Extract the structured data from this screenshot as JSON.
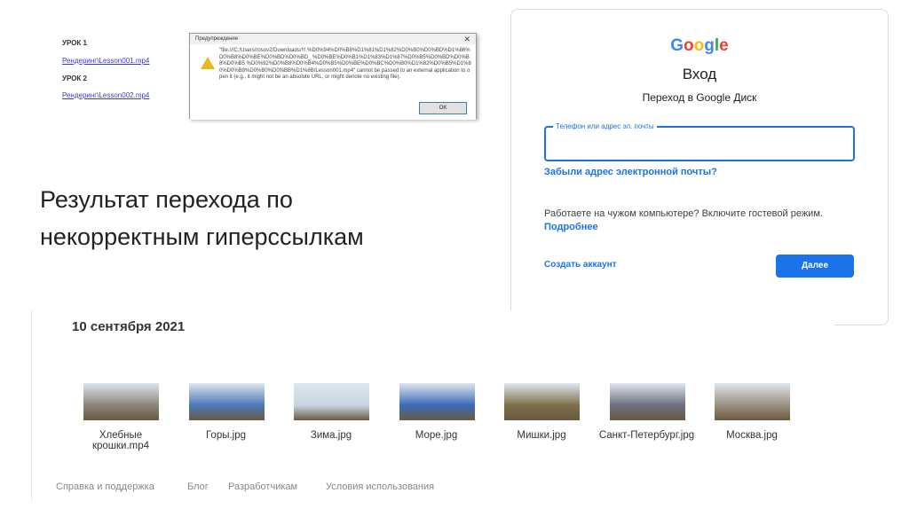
{
  "doc": {
    "lessons": [
      {
        "title": "УРОК 1",
        "link": "Рендеринг\\Lesson001.mp4"
      },
      {
        "title": "УРОК 2",
        "link": "Рендеринг\\Lesson002.mp4"
      }
    ]
  },
  "dialog": {
    "title": "Предупреждение",
    "close": "✕",
    "message": "\"file:///C:/Users/rosov2/Downloads/!!! %D0%94%D0%B8%D1%81%D1%82%D0%B0%D0%BD%D1%86%D0%B8%D0%BE%D0%BD%D0%BD_ %D0%BE%D0%B1%D1%83%D1%87%D0%B5%D0%BD%D0%B8%D0%B5 %D0%92%D0%B8%D0%B4%D0%B5%D0%BE%D0%BC%D0%B0%D1%82%D0%B5%D1%80%D0%B8%D0%B0%D0%BB%D1%8B/Lesson001.mp4\" cannot be passed to an external application to open it (e.g., it might not be an absolute URL, or might denote no existing file).",
    "ok": "OK"
  },
  "google": {
    "logo": "Google",
    "title": "Вход",
    "subtitle": "Переход в Google Диск",
    "field_label": "Телефон или адрес эл. почты",
    "field_value": "",
    "forgot": "Забыли адрес электронной почты?",
    "guest_text": "Работаете на чужом компьютере? Включите гостевой режим.",
    "guest_link": "Подробнее",
    "create": "Создать аккаунт",
    "next": "Далее",
    "colors": [
      "#4285f4",
      "#ea4335",
      "#fbbc05",
      "#4285f4",
      "#34a853",
      "#ea4335"
    ]
  },
  "caption": {
    "line1": "Результат перехода по",
    "line2": "некорректным гиперссылкам"
  },
  "files": {
    "date": "10 сентября 2021",
    "items": [
      {
        "name": "Хлебные крошки.mp4",
        "color": "#8a8478"
      },
      {
        "name": "Горы.jpg",
        "color": "#4a78b8"
      },
      {
        "name": "Зима.jpg",
        "color": "#c8d4e0"
      },
      {
        "name": "Море.jpg",
        "color": "#3a6ab8"
      },
      {
        "name": "Мишки.jpg",
        "color": "#7a7048"
      },
      {
        "name": "Санкт-Петербург.jpg",
        "color": "#6a7080"
      },
      {
        "name": "Москва.jpg",
        "color": "#9a8e80"
      }
    ],
    "footer": [
      "Справка и поддержка",
      "Блог",
      "Разработчикам",
      "Условия использования"
    ]
  }
}
